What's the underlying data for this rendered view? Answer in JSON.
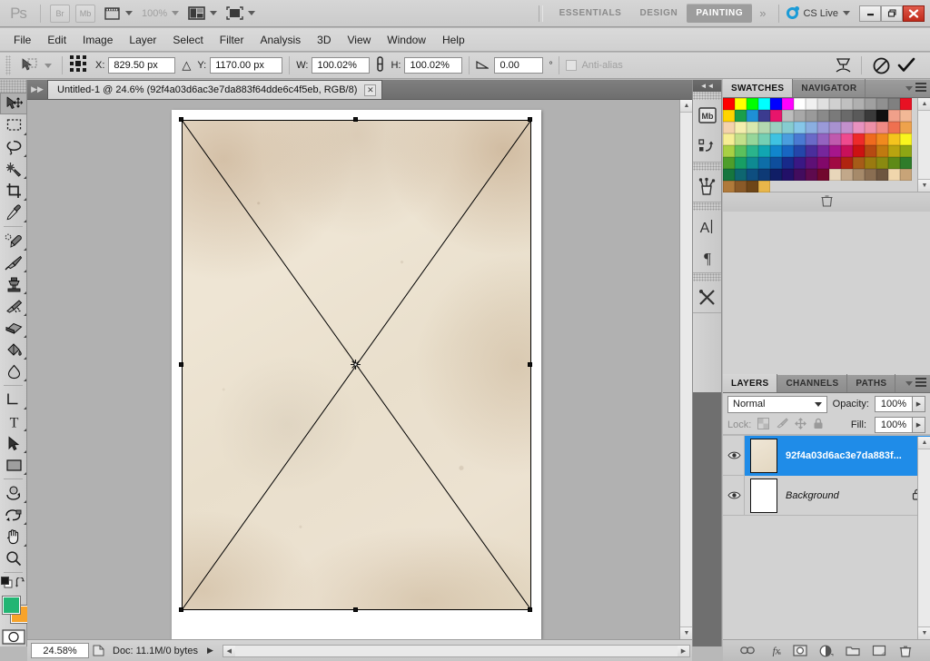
{
  "app": {
    "logo": "Ps",
    "bridge_label": "Br",
    "minibridge_label": "Mb",
    "zoom_level_label": "100%",
    "workspaces": [
      {
        "label": "ESSENTIALS",
        "active": false
      },
      {
        "label": "DESIGN",
        "active": false
      },
      {
        "label": "PAINTING",
        "active": true
      }
    ],
    "more_workspaces": "»",
    "cs_live": "CS Live",
    "window_buttons": {
      "minimize": "–",
      "restore": "❐",
      "close": "✕"
    }
  },
  "menubar": {
    "items": [
      "File",
      "Edit",
      "Image",
      "Layer",
      "Select",
      "Filter",
      "Analysis",
      "3D",
      "View",
      "Window",
      "Help"
    ]
  },
  "options_bar": {
    "tool_name": "move-tool",
    "reference_point_label": "reference-point-selector",
    "x_label": "X:",
    "x_value": "829.50 px",
    "delta_symbol": "△",
    "y_label": "Y:",
    "y_value": "1170.00 px",
    "w_label": "W:",
    "w_value": "100.02%",
    "link_label": "maintain-aspect-ratio",
    "h_label": "H:",
    "h_value": "100.02%",
    "angle_label": "∠",
    "angle_value": "0.00",
    "degree_symbol": "°",
    "antialias_label": "Anti-alias",
    "warp_label": "switch-to-warp-mode",
    "cancel_label": "cancel-transform",
    "commit_label": "commit-transform"
  },
  "toolbar": {
    "tools": [
      {
        "name": "move-tool",
        "selected": true,
        "has_submenu": false
      },
      {
        "name": "rectangular-marquee-tool",
        "selected": false,
        "has_submenu": true
      },
      {
        "name": "lasso-tool",
        "selected": false,
        "has_submenu": true
      },
      {
        "name": "quick-selection-tool",
        "selected": false,
        "has_submenu": true
      },
      {
        "name": "crop-tool",
        "selected": false,
        "has_submenu": true
      },
      {
        "name": "eyedropper-tool",
        "selected": false,
        "has_submenu": true
      },
      {
        "name": "spot-healing-brush-tool",
        "selected": false,
        "has_submenu": true
      },
      {
        "name": "brush-tool",
        "selected": false,
        "has_submenu": true
      },
      {
        "name": "clone-stamp-tool",
        "selected": false,
        "has_submenu": true
      },
      {
        "name": "history-brush-tool",
        "selected": false,
        "has_submenu": true
      },
      {
        "name": "eraser-tool",
        "selected": false,
        "has_submenu": true
      },
      {
        "name": "gradient-tool",
        "selected": false,
        "has_submenu": true
      },
      {
        "name": "blur-tool",
        "selected": false,
        "has_submenu": true
      },
      {
        "name": "dodge-tool",
        "selected": false,
        "has_submenu": true
      },
      {
        "name": "pen-tool",
        "selected": false,
        "has_submenu": true
      },
      {
        "name": "horizontal-type-tool",
        "selected": false,
        "has_submenu": true
      },
      {
        "name": "path-selection-tool",
        "selected": false,
        "has_submenu": true
      },
      {
        "name": "rectangle-tool",
        "selected": false,
        "has_submenu": true
      },
      {
        "name": "3d-object-rotate-tool",
        "selected": false,
        "has_submenu": true
      },
      {
        "name": "3d-camera-rotate-tool",
        "selected": false,
        "has_submenu": true
      },
      {
        "name": "hand-tool",
        "selected": false,
        "has_submenu": true
      },
      {
        "name": "zoom-tool",
        "selected": false,
        "has_submenu": false
      }
    ],
    "foreground_color": "#22b573",
    "background_color": "#f7a32a",
    "quick_mask_label": "edit-in-quick-mask-mode"
  },
  "document": {
    "tab_title": "Untitled-1 @ 24.6% (92f4a03d6ac3e7da883f64dde6c4f5eb, RGB/8)",
    "close_label": "✕"
  },
  "status_bar": {
    "zoom": "24.58%",
    "doc_info": "Doc: 11.1M/0 bytes",
    "expand_arrow": "▶"
  },
  "icon_dock": {
    "collapse_label": "◄◄",
    "buttons": [
      {
        "name": "mini-bridge-icon",
        "glyph": "Mb"
      },
      {
        "name": "history-icon",
        "glyph": ""
      },
      {
        "name": "brush-presets-icon",
        "glyph": ""
      },
      {
        "name": "character-panel-icon",
        "glyph": "A"
      },
      {
        "name": "paragraph-panel-icon",
        "glyph": "¶"
      },
      {
        "name": "tool-presets-icon",
        "glyph": ""
      }
    ]
  },
  "swatches_panel": {
    "tabs": [
      {
        "label": "SWATCHES",
        "active": true
      },
      {
        "label": "NAVIGATOR",
        "active": false
      }
    ],
    "colors": [
      "#ff0000",
      "#ffff00",
      "#00ff00",
      "#00ffff",
      "#0000ff",
      "#ff00ff",
      "#ffffff",
      "#f0f0f0",
      "#e0e0e0",
      "#d0d0d0",
      "#c0c0c0",
      "#b0b0b0",
      "#a0a0a0",
      "#909090",
      "#808080",
      "#e81123",
      "#ffd400",
      "#1a9e4b",
      "#1e90d6",
      "#3b3b8f",
      "#e8156b",
      "#bdbdbd",
      "#a8a8a8",
      "#9a9a9a",
      "#8a8a8a",
      "#7a7a7a",
      "#6a6a6a",
      "#5a5a5a",
      "#3a3a3a",
      "#101010",
      "#f0a08a",
      "#f2b896",
      "#f4d2ac",
      "#f4eeae",
      "#d8e8ae",
      "#b4d8b0",
      "#9ad0c0",
      "#86ccd0",
      "#86c6e8",
      "#8aaee0",
      "#9a9ad8",
      "#a892d0",
      "#c290cc",
      "#e892c0",
      "#ee90a8",
      "#f08a84",
      "#ef7050",
      "#eea24c",
      "#f6ee94",
      "#c2e08a",
      "#96d69a",
      "#74cfb4",
      "#3fc2e2",
      "#4a9ede",
      "#4a7ad2",
      "#6a6ac8",
      "#9462c0",
      "#c05aae",
      "#ee4a8e",
      "#ee2a2a",
      "#ef6a1e",
      "#f08a1e",
      "#f4c41e",
      "#f9f51e",
      "#a8d044",
      "#5cc05c",
      "#2ab48c",
      "#11a6b2",
      "#1186cc",
      "#1866c2",
      "#2446aa",
      "#4a2e9c",
      "#76269c",
      "#a6168c",
      "#c8105a",
      "#cc1212",
      "#b64a12",
      "#c07a10",
      "#b8a410",
      "#8ea614",
      "#4e9e2a",
      "#179e64",
      "#0e8a92",
      "#0e6ea8",
      "#0e4e9c",
      "#182a8a",
      "#3a1884",
      "#5e1076",
      "#82086a",
      "#a00a42",
      "#b02410",
      "#a65c18",
      "#9a7a10",
      "#8a8a10",
      "#5e8a16",
      "#2f7c2a",
      "#16763e",
      "#0e6670",
      "#0e4e80",
      "#0e3a76",
      "#101e66",
      "#221068",
      "#420c5e",
      "#5e0a4e",
      "#72082e",
      "#e8d6ba",
      "#c2a88a",
      "#a68a6a",
      "#8a6e52",
      "#6e5640",
      "#f0d6ac",
      "#c8a478",
      "#b07a3a",
      "#8a5a28",
      "#6e4618",
      "#e8b64a"
    ]
  },
  "layers_panel": {
    "tabs": [
      {
        "label": "LAYERS",
        "active": true
      },
      {
        "label": "CHANNELS",
        "active": false
      },
      {
        "label": "PATHS",
        "active": false
      }
    ],
    "blend_mode": "Normal",
    "opacity_label": "Opacity:",
    "opacity_value": "100%",
    "lock_label": "Lock:",
    "lock_buttons": [
      "lock-transparent-pixels",
      "lock-image-pixels",
      "lock-position",
      "lock-all"
    ],
    "fill_label": "Fill:",
    "fill_value": "100%",
    "layers": [
      {
        "name": "92f4a03d6ac3e7da883f...",
        "visible": true,
        "selected": true,
        "locked": false,
        "italic": false
      },
      {
        "name": "Background",
        "visible": true,
        "selected": false,
        "locked": true,
        "italic": true
      }
    ],
    "footer_buttons": [
      "link-layers-icon",
      "add-layer-style-icon",
      "add-layer-mask-icon",
      "new-adjustment-layer-icon",
      "new-group-icon",
      "new-layer-icon",
      "delete-layer-icon"
    ]
  }
}
